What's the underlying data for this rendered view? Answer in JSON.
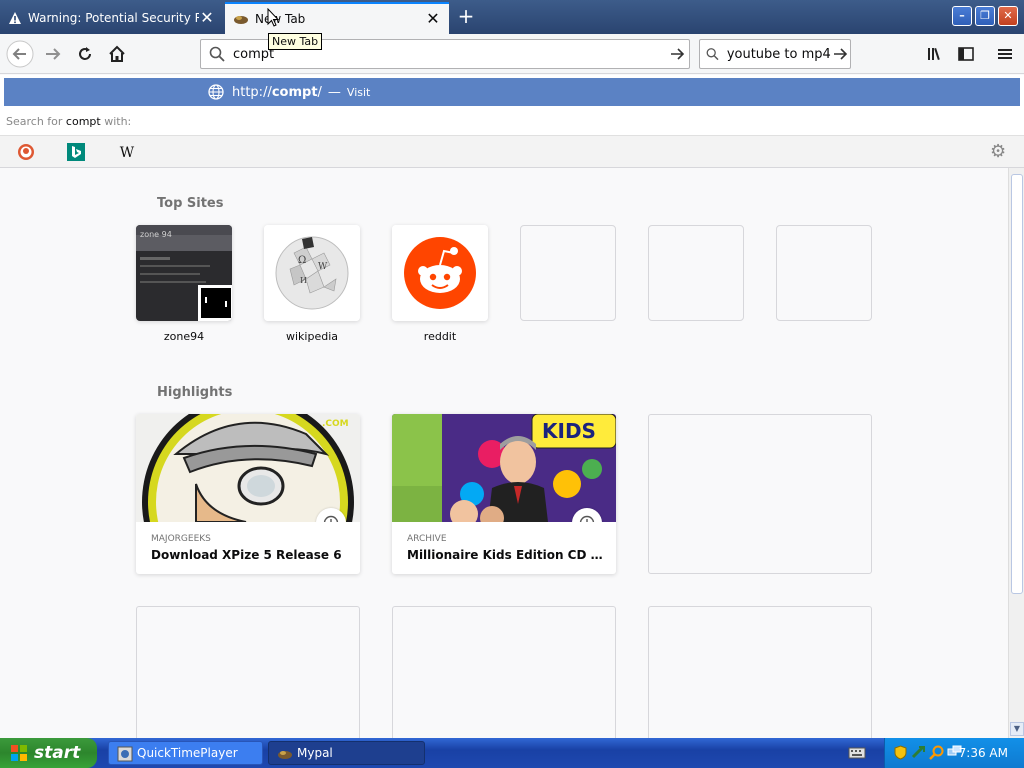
{
  "tabs": [
    {
      "title": "Warning: Potential Security Risk Ahead",
      "active": false
    },
    {
      "title": "New Tab",
      "active": true
    }
  ],
  "tooltip": "New Tab",
  "urlbar": {
    "value": "compt"
  },
  "searchbar": {
    "value": "youtube to mp4"
  },
  "dropdown": {
    "suggestion_prefix": "http://",
    "suggestion_bold": "compt",
    "suggestion_suffix": "/",
    "suggestion_sep": "—",
    "suggestion_action": "Visit",
    "search_for_prefix": "Search for",
    "search_for_query": "compt",
    "search_for_suffix": "with:"
  },
  "top_sites": {
    "title": "Top Sites",
    "items": [
      {
        "label": "zone94"
      },
      {
        "label": "wikipedia"
      },
      {
        "label": "reddit"
      },
      {
        "label": ""
      },
      {
        "label": ""
      },
      {
        "label": ""
      }
    ]
  },
  "highlights": {
    "title": "Highlights",
    "items": [
      {
        "source": "MAJORGEEKS",
        "title": "Download XPize 5 Release 6"
      },
      {
        "source": "ARCHIVE",
        "title": "Millionaire Kids Edition CD : Free ..."
      }
    ]
  },
  "taskbar": {
    "start": "start",
    "items": [
      {
        "label": "QuickTimePlayer"
      },
      {
        "label": "Mypal"
      }
    ],
    "time": "7:36 AM"
  },
  "colors": {
    "accent": "#0a84ff",
    "suggestion_bg": "#5b82c4",
    "reddit": "#ff4500"
  }
}
